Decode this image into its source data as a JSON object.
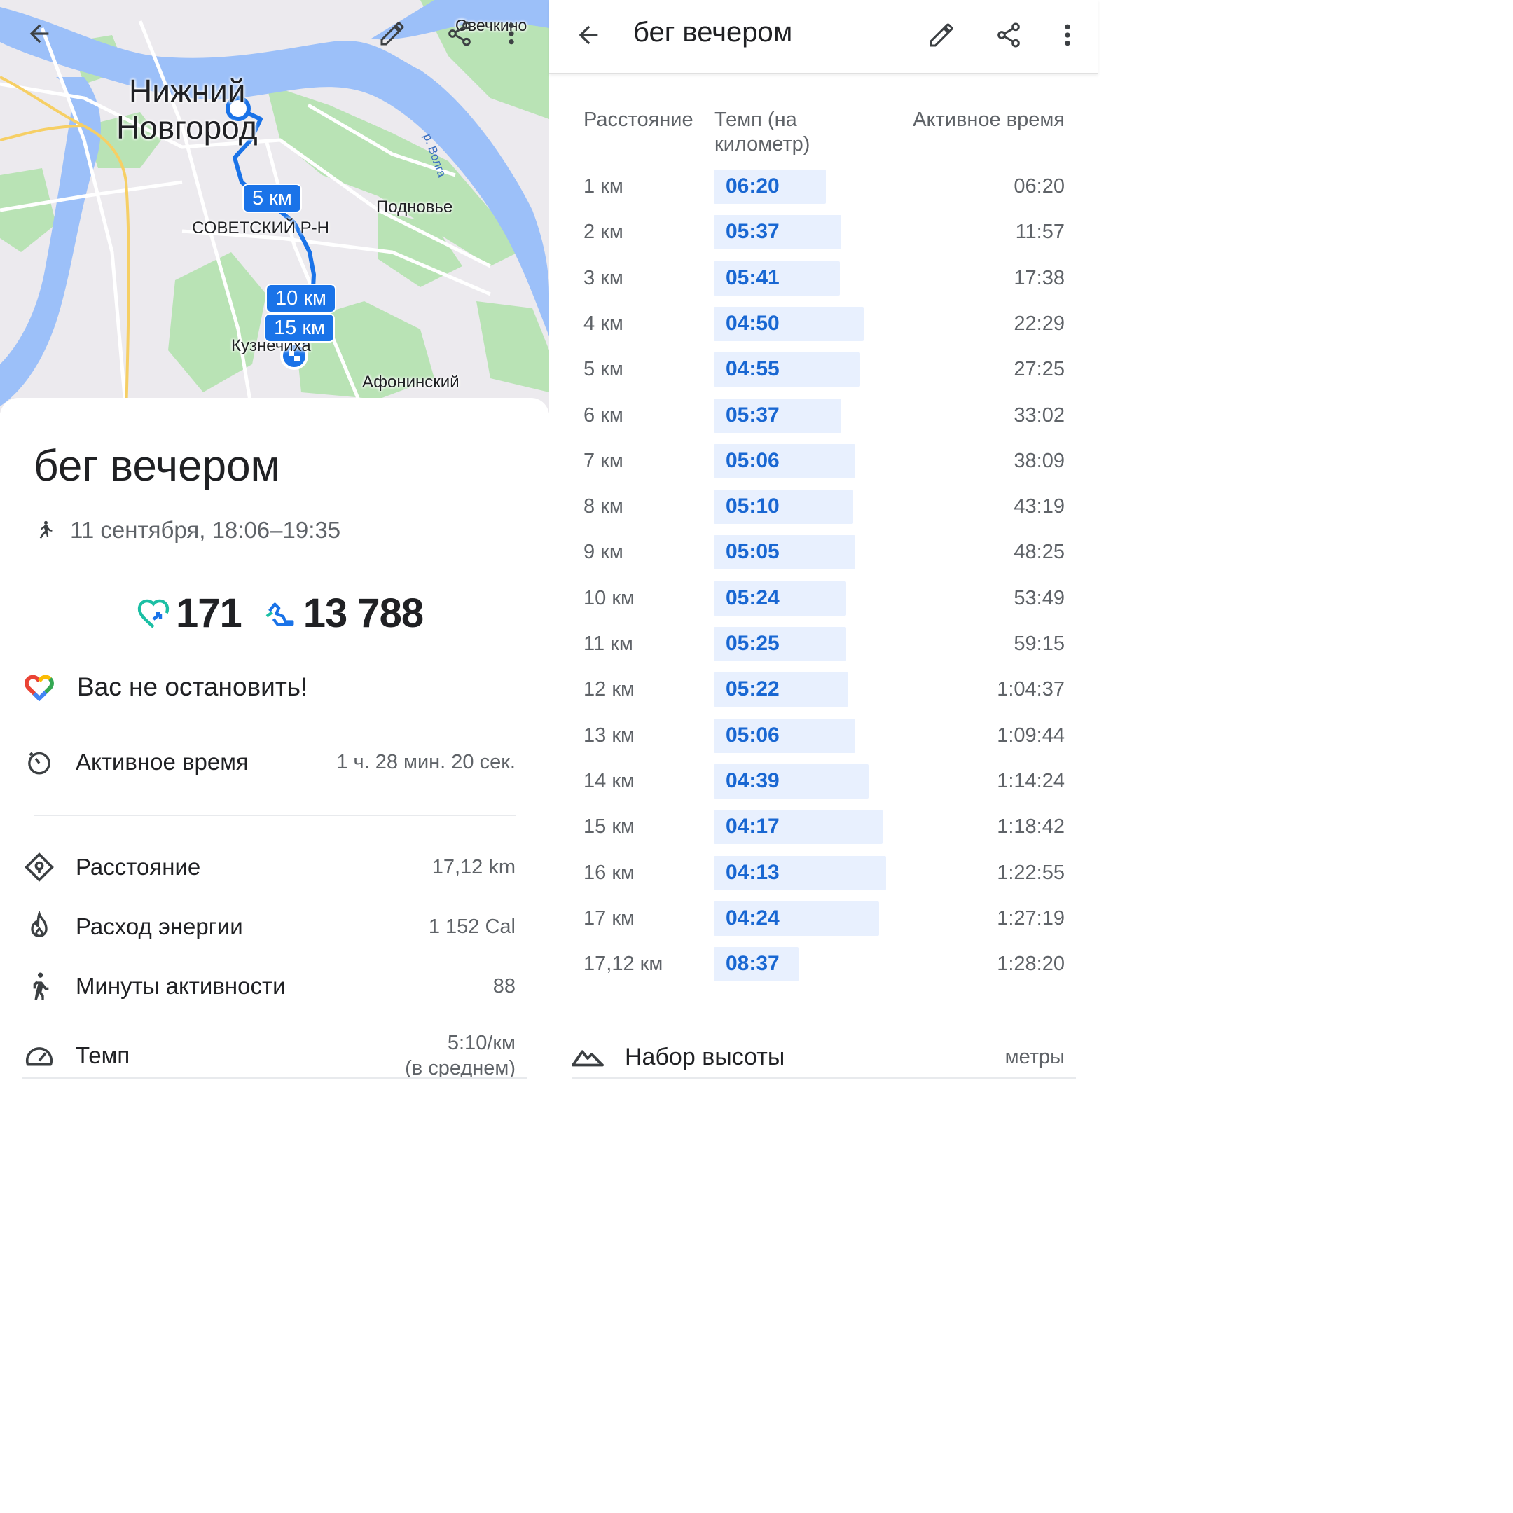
{
  "activity": {
    "title": "бег вечером",
    "date_time": "11 сентября, 18:06–19:35",
    "heart_points": "171",
    "steps": "13 788",
    "motivation": "Вас не остановить!"
  },
  "map": {
    "labels": {
      "city_line1": "Нижний",
      "city_line2": "Новгород",
      "district": "СОВЕТСКИЙ Р-Н",
      "podnovye": "Подновье",
      "ovechkino": "Овечкино",
      "kuznechikha": "Кузнечиха",
      "afoninsky": "Афонинский",
      "river": "р. Волга"
    },
    "km_markers": [
      "5 км",
      "10 км",
      "15 км"
    ]
  },
  "metrics": {
    "active_time": {
      "label": "Активное время",
      "value": "1 ч. 28 мин. 20 сек."
    },
    "distance": {
      "label": "Расстояние",
      "value": "17,12 km"
    },
    "energy": {
      "label": "Расход энергии",
      "value": "1 152 Cal"
    },
    "active_minutes": {
      "label": "Минуты активности",
      "value": "88"
    },
    "pace": {
      "label": "Темп",
      "value_line1": "5:10/км",
      "value_line2": "(в среднем)"
    }
  },
  "splits": {
    "header": {
      "distance": "Расстояние",
      "pace_line1": "Темп (на",
      "pace_line2": "километр)",
      "active_time": "Активное время"
    },
    "rows": [
      {
        "dist": "1 км",
        "pace": "06:20",
        "time": "06:20",
        "speed": 0.65
      },
      {
        "dist": "2 км",
        "pace": "05:37",
        "time": "11:57",
        "speed": 0.74
      },
      {
        "dist": "3 км",
        "pace": "05:41",
        "time": "17:38",
        "speed": 0.73
      },
      {
        "dist": "4 км",
        "pace": "04:50",
        "time": "22:29",
        "speed": 0.87
      },
      {
        "dist": "5 км",
        "pace": "04:55",
        "time": "27:25",
        "speed": 0.85
      },
      {
        "dist": "6 км",
        "pace": "05:37",
        "time": "33:02",
        "speed": 0.74
      },
      {
        "dist": "7 км",
        "pace": "05:06",
        "time": "38:09",
        "speed": 0.82
      },
      {
        "dist": "8 км",
        "pace": "05:10",
        "time": "43:19",
        "speed": 0.81
      },
      {
        "dist": "9 км",
        "pace": "05:05",
        "time": "48:25",
        "speed": 0.82
      },
      {
        "dist": "10 км",
        "pace": "05:24",
        "time": "53:49",
        "speed": 0.77
      },
      {
        "dist": "11 км",
        "pace": "05:25",
        "time": "59:15",
        "speed": 0.77
      },
      {
        "dist": "12 км",
        "pace": "05:22",
        "time": "1:04:37",
        "speed": 0.78
      },
      {
        "dist": "13 км",
        "pace": "05:06",
        "time": "1:09:44",
        "speed": 0.82
      },
      {
        "dist": "14 км",
        "pace": "04:39",
        "time": "1:14:24",
        "speed": 0.9
      },
      {
        "dist": "15 км",
        "pace": "04:17",
        "time": "1:18:42",
        "speed": 0.98
      },
      {
        "dist": "16 км",
        "pace": "04:13",
        "time": "1:22:55",
        "speed": 1.0
      },
      {
        "dist": "17 км",
        "pace": "04:24",
        "time": "1:27:19",
        "speed": 0.96
      },
      {
        "dist": "17,12 км",
        "pace": "08:37",
        "time": "1:28:20",
        "speed": 0.49
      }
    ]
  },
  "elevation": {
    "label": "Набор высоты",
    "unit": "метры"
  },
  "colors": {
    "accent": "#1a73e8",
    "pace_text": "#1967d2",
    "pace_bar": "#e8f0fe",
    "water": "#9cc0f9",
    "park": "#b5e2b3",
    "heart_points": "#1bbfa4"
  }
}
